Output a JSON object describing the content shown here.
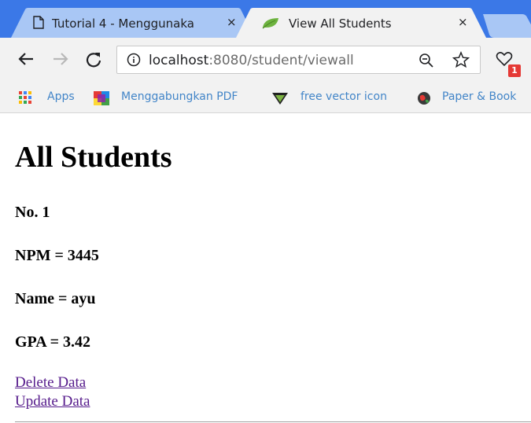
{
  "browser": {
    "tabs": [
      {
        "title": "Tutorial 4 - Menggunaka",
        "active": false,
        "icon": "document-icon"
      },
      {
        "title": "View All Students",
        "active": true,
        "icon": "leaf-icon"
      }
    ],
    "close_glyph": "×",
    "address": {
      "host": "localhost",
      "path": ":8080/student/viewall"
    },
    "extension_badge": "1",
    "bookmarks": [
      {
        "label": "Apps",
        "icon": "apps-grid-icon"
      },
      {
        "label": "Menggabungkan PDF",
        "icon": "pdf-merge-icon"
      },
      {
        "label": "free vector icon",
        "icon": "vector-icon"
      },
      {
        "label": "Paper & Book",
        "icon": "globe-icon"
      }
    ]
  },
  "page": {
    "title": "All Students",
    "student": {
      "number": "No. 1",
      "npm": "NPM = 3445",
      "name": "Name = ayu",
      "gpa": "GPA = 3.42"
    },
    "links": {
      "delete": "Delete Data",
      "update": "Update Data"
    }
  },
  "colors": {
    "tab_strip": "#3b78e7",
    "toolbar": "#f2f2f2",
    "visited_link": "#551a8b",
    "bookmark_text": "#4285c8"
  }
}
